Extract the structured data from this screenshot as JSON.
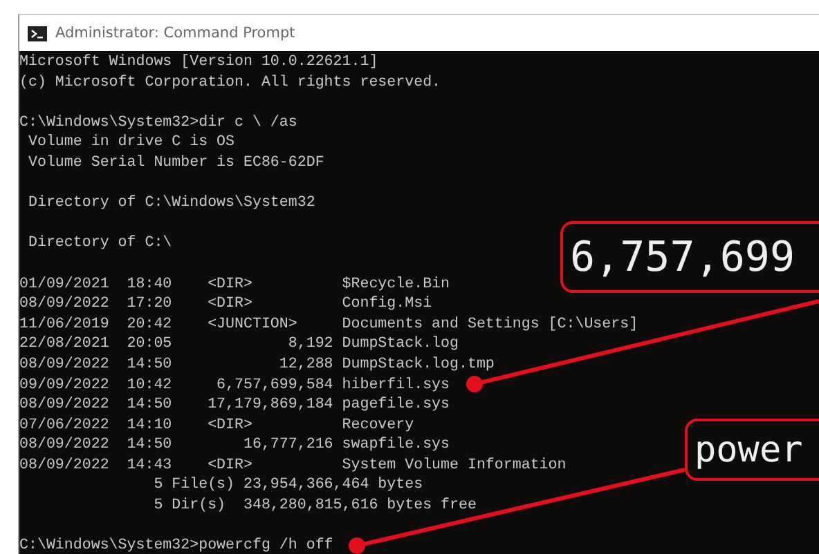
{
  "window": {
    "title": "Administrator: Command Prompt"
  },
  "console_blocks": [
    [
      "Microsoft Windows [Version 10.0.22621.1]",
      "(c) Microsoft Corporation. All rights reserved."
    ],
    [
      "C:\\Windows\\System32>dir c \\ /as",
      " Volume in drive C is OS",
      " Volume Serial Number is EC86-62DF"
    ],
    [
      " Directory of C:\\Windows\\System32"
    ],
    [
      " Directory of C:\\"
    ],
    [
      "01/09/2021  18:40    <DIR>          $Recycle.Bin",
      "08/09/2022  17:20    <DIR>          Config.Msi",
      "11/06/2019  20:42    <JUNCTION>     Documents and Settings [C:\\Users]",
      "22/08/2021  20:05             8,192 DumpStack.log",
      "08/09/2022  14:50            12,288 DumpStack.log.tmp",
      "09/09/2022  10:42     6,757,699,584 hiberfil.sys",
      "08/09/2022  14:50    17,179,869,184 pagefile.sys",
      "07/06/2022  14:10    <DIR>          Recovery",
      "08/09/2022  14:50        16,777,216 swapfile.sys",
      "08/09/2022  14:43    <DIR>          System Volume Information",
      "               5 File(s) 23,954,366,464 bytes",
      "               5 Dir(s)  348,280,815,616 bytes free"
    ],
    [
      "C:\\Windows\\System32>powercfg /h off"
    ]
  ],
  "callouts": [
    {
      "text": "6,757,699"
    },
    {
      "text": "power"
    }
  ]
}
